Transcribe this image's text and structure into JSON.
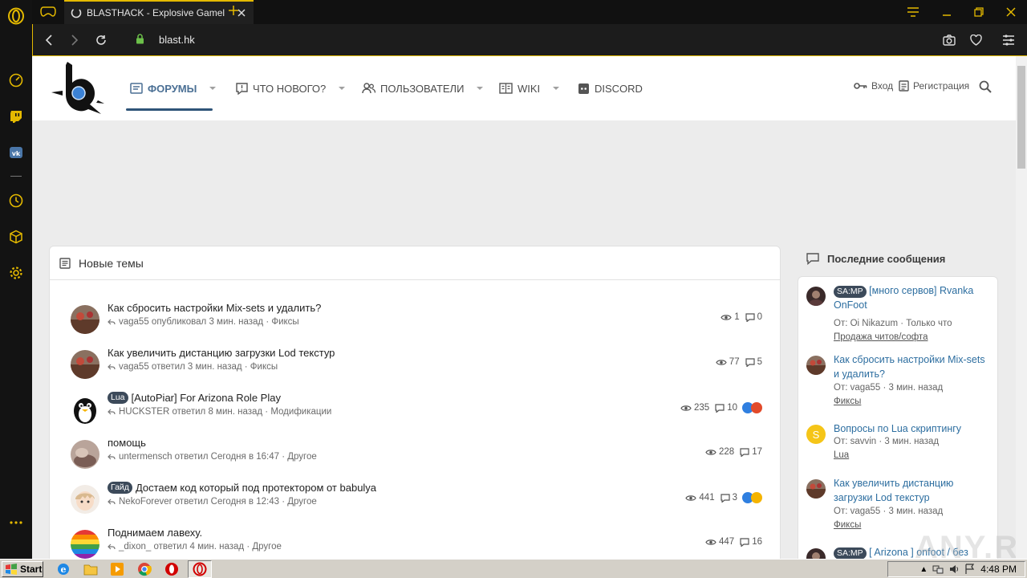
{
  "browser": {
    "tab_title": "BLASTHACK - Explosive Gamel",
    "url": "blast.hk"
  },
  "header": {
    "nav": [
      {
        "label": "ФОРУМЫ",
        "icon": "forum-icon"
      },
      {
        "label": "ЧТО НОВОГО?",
        "icon": "whats-new-icon"
      },
      {
        "label": "ПОЛЬЗОВАТЕЛИ",
        "icon": "users-icon"
      },
      {
        "label": "WIKI",
        "icon": "wiki-icon"
      },
      {
        "label": "DISCORD",
        "icon": "discord-icon"
      }
    ],
    "login_label": "Вход",
    "register_label": "Регистрация"
  },
  "new_topics": {
    "title": "Новые темы",
    "items": [
      {
        "title": "Как сбросить настройки Mix-sets и удалить?",
        "prefix": "",
        "meta": "vaga55 опубликовал 3 мин. назад · Фиксы",
        "views": "1",
        "replies": "0"
      },
      {
        "title": "Как увеличить дистанцию загрузки Lod текстур",
        "prefix": "",
        "meta": "vaga55 ответил 3 мин. назад · Фиксы",
        "views": "77",
        "replies": "5"
      },
      {
        "title": "[AutoPiar] For Arizona Role Play",
        "prefix": "Lua",
        "meta": "HUCKSTER ответил 8 мин. назад · Модификации",
        "views": "235",
        "replies": "10"
      },
      {
        "title": "помощь",
        "prefix": "",
        "meta": "untermensch ответил Сегодня в 16:47 · Другое",
        "views": "228",
        "replies": "17"
      },
      {
        "title": "Достаем код который под протектором от babulya",
        "prefix": "Гайд",
        "meta": "NekoForever ответил Сегодня в 12:43 · Другое",
        "views": "441",
        "replies": "3"
      },
      {
        "title": "Поднимаем лавеху.",
        "prefix": "",
        "meta": "_dixon_ ответил 4 мин. назад · Другое",
        "views": "447",
        "replies": "16"
      }
    ]
  },
  "latest_posts": {
    "title": "Последние сообщения",
    "items": [
      {
        "prefix": "SA:MP",
        "title": "[много сервов] Rvanka OnFoot",
        "meta": "От: Oi Nikazum · Только что",
        "forum": "Продажа читов/софта"
      },
      {
        "prefix": "",
        "title": "Как сбросить настройки Mix-sets и удалить?",
        "meta": "От: vaga55 · 3 мин. назад",
        "forum": "Фиксы"
      },
      {
        "prefix": "",
        "title": "Вопросы по Lua скриптингу",
        "meta": "От: savvin · 3 мин. назад",
        "forum": "Lua",
        "avatar_letter": "S"
      },
      {
        "prefix": "",
        "title": "Как увеличить дистанцию загрузки Lod текстур",
        "meta": "От: vaga55 · 3 мин. назад",
        "forum": "Фиксы"
      },
      {
        "prefix": "SA:MP",
        "title": "[ Arizona ] onfoot / без",
        "meta": "",
        "forum": ""
      }
    ]
  },
  "watermark": "ANY.RUN",
  "taskbar": {
    "start_label": "Start",
    "clock": "4:48 PM"
  },
  "colors": {
    "accent": "#e4b900",
    "link": "#2d6ea0",
    "nav_active": "#4a6f94"
  }
}
